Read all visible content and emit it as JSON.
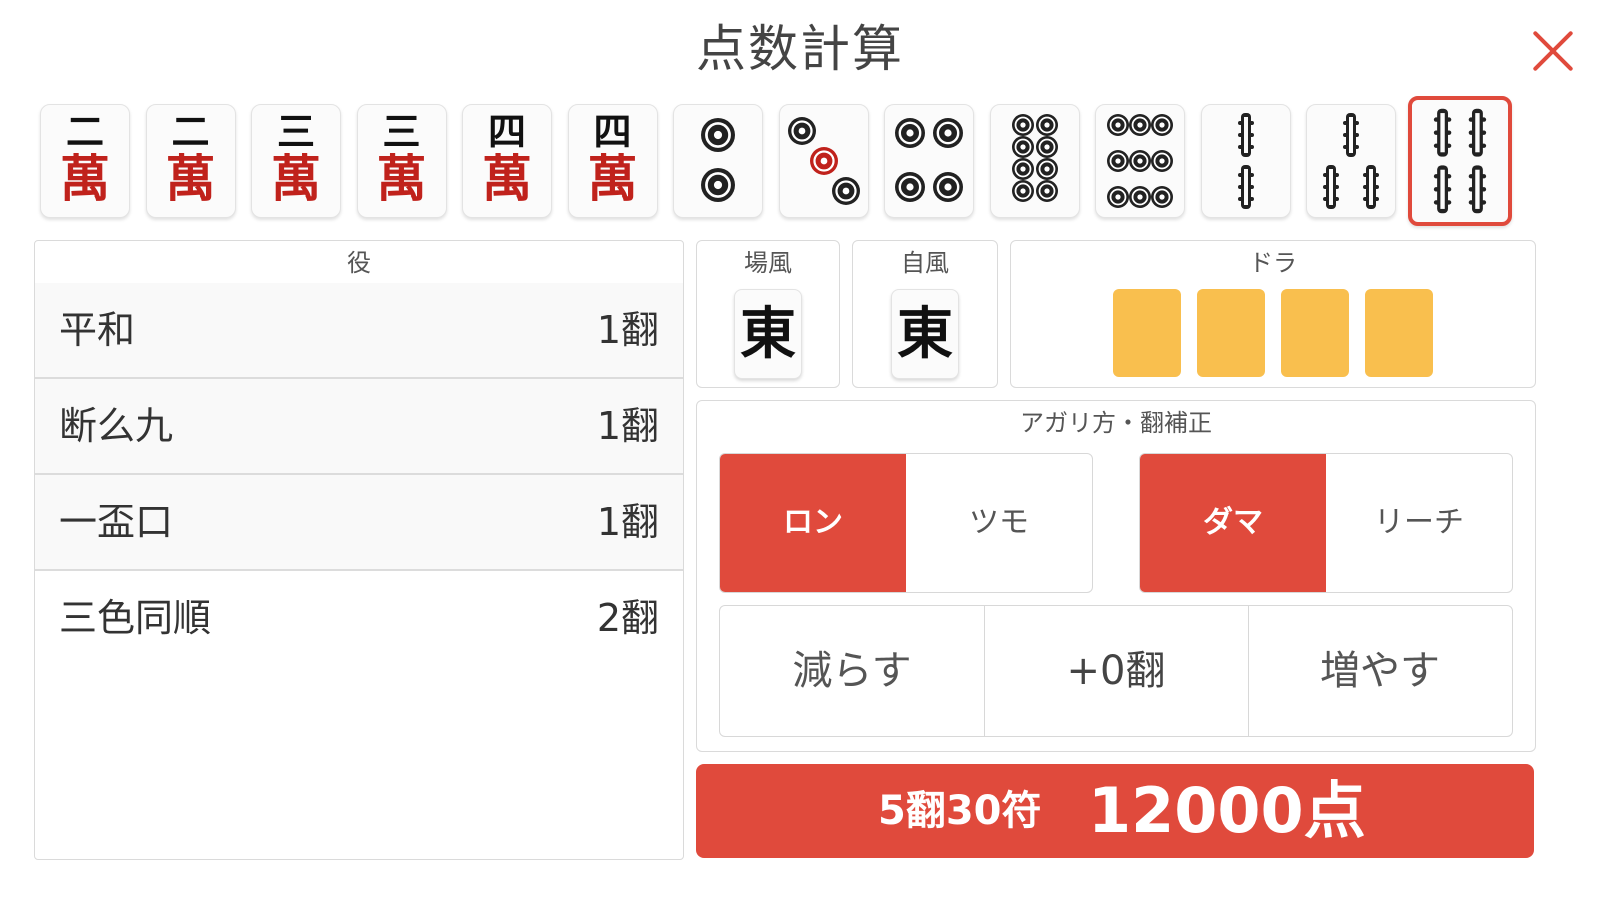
{
  "title": "点数計算",
  "colors": {
    "accent": "#e04a3c",
    "dora": "#f9bf4e",
    "man_red": "#c0221c"
  },
  "hand": [
    {
      "suit": "man",
      "rank": 2,
      "number": "二",
      "suit_char": "萬"
    },
    {
      "suit": "man",
      "rank": 2,
      "number": "二",
      "suit_char": "萬"
    },
    {
      "suit": "man",
      "rank": 3,
      "number": "三",
      "suit_char": "萬"
    },
    {
      "suit": "man",
      "rank": 3,
      "number": "三",
      "suit_char": "萬"
    },
    {
      "suit": "man",
      "rank": 4,
      "number": "四",
      "suit_char": "萬"
    },
    {
      "suit": "man",
      "rank": 4,
      "number": "四",
      "suit_char": "萬"
    },
    {
      "suit": "pin",
      "rank": 2
    },
    {
      "suit": "pin",
      "rank": 3
    },
    {
      "suit": "pin",
      "rank": 4
    },
    {
      "suit": "pin",
      "rank": 8
    },
    {
      "suit": "pin",
      "rank": 9
    },
    {
      "suit": "sou",
      "rank": 2
    },
    {
      "suit": "sou",
      "rank": 3
    },
    {
      "suit": "sou",
      "rank": 4,
      "selected": true
    }
  ],
  "yaku": {
    "label": "役",
    "items": [
      {
        "name": "平和",
        "han": "1翻"
      },
      {
        "name": "断么九",
        "han": "1翻"
      },
      {
        "name": "一盃口",
        "han": "1翻"
      },
      {
        "name": "三色同順",
        "han": "2翻"
      }
    ]
  },
  "round_wind": {
    "label": "場風",
    "tile": "東"
  },
  "seat_wind": {
    "label": "自風",
    "tile": "東"
  },
  "dora": {
    "label": "ドラ",
    "slots": 4
  },
  "agari": {
    "label": "アガリ方・翻補正",
    "win_type": {
      "options": [
        "ロン",
        "ツモ"
      ],
      "selected": "ロン"
    },
    "riichi": {
      "options": [
        "ダマ",
        "リーチ"
      ],
      "selected": "ダマ"
    },
    "adjust": {
      "decrease": "減らす",
      "value": "+0翻",
      "increase": "増やす"
    }
  },
  "result": {
    "han_fu": "5翻30符",
    "points": "12000点"
  }
}
